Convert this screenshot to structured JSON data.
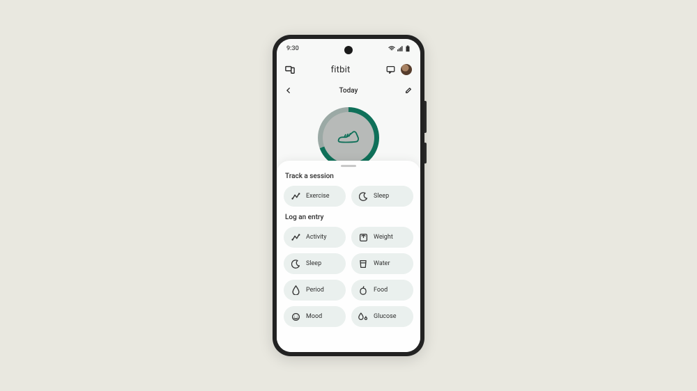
{
  "status_bar": {
    "time": "9:30"
  },
  "topbar": {
    "app_brand": "fitbit"
  },
  "subheader": {
    "date_label": "Today"
  },
  "sheet": {
    "track_title": "Track a session",
    "log_title": "Log an entry",
    "track_items": [
      {
        "label": "Exercise"
      },
      {
        "label": "Sleep"
      }
    ],
    "log_items": [
      {
        "label": "Activity"
      },
      {
        "label": "Weight"
      },
      {
        "label": "Sleep"
      },
      {
        "label": "Water"
      },
      {
        "label": "Period"
      },
      {
        "label": "Food"
      },
      {
        "label": "Mood"
      },
      {
        "label": "Glucose"
      }
    ]
  }
}
